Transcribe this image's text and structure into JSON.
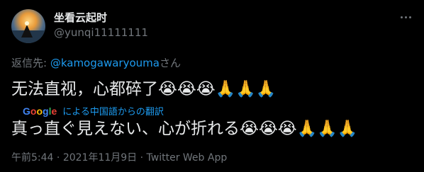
{
  "user": {
    "display_name": "坐看云起时",
    "handle": "@yunqi11111111",
    "avatar_icon": "sunset-avatar"
  },
  "more_icon": "more-horizontal-icon",
  "reply": {
    "prefix": "返信先: ",
    "mention": "@kamogawaryouma",
    "suffix": "さん"
  },
  "tweet": {
    "original": "无法直视，心都碎了😭😭😭🙏🙏🙏",
    "translated": "真っ直ぐ見えない、心が折れる😭😭😭🙏🙏🙏"
  },
  "translation": {
    "provider": "Google",
    "link_text": "による中国語からの翻訳"
  },
  "meta": {
    "time": "午前5:44",
    "separator": " · ",
    "date": "2021年11月9日",
    "app": "Twitter Web App"
  },
  "colors": {
    "background": "#000000",
    "text": "#e7e9ea",
    "secondary": "#71767b",
    "link": "#1d9bf0"
  }
}
